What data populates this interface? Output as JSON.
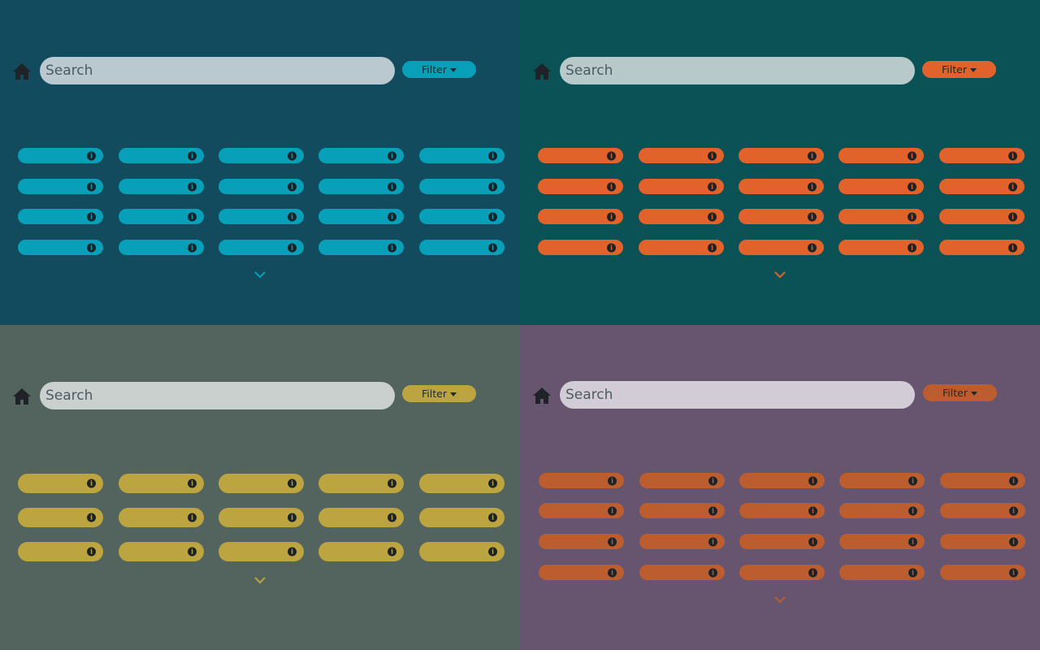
{
  "panels": [
    {
      "theme": "teal",
      "background": "#124a5e",
      "accent": "#08a0b8",
      "search_bg": "#b9c9cf",
      "search": {
        "placeholder": "Search",
        "value": ""
      },
      "filter": {
        "label": "Filter",
        "icon": "caret-down-icon"
      },
      "home_icon": "home-icon",
      "grid": {
        "rows": 4,
        "columns": 5,
        "item_icon": "info-icon"
      },
      "more_icon": "chevron-down-icon"
    },
    {
      "theme": "orange-on-teal",
      "background": "#0a5256",
      "accent": "#e2622c",
      "search_bg": "#b8c9ca",
      "search": {
        "placeholder": "Search",
        "value": ""
      },
      "filter": {
        "label": "Filter",
        "icon": "caret-down-icon"
      },
      "home_icon": "home-icon",
      "grid": {
        "rows": 4,
        "columns": 5,
        "item_icon": "info-icon"
      },
      "more_icon": "chevron-down-icon"
    },
    {
      "theme": "gold",
      "background": "#52645d",
      "accent": "#bca441",
      "search_bg": "#c9d0cd",
      "search": {
        "placeholder": "Search",
        "value": ""
      },
      "filter": {
        "label": "Filter",
        "icon": "caret-down-icon"
      },
      "home_icon": "home-icon",
      "grid": {
        "rows": 3,
        "columns": 5,
        "item_icon": "info-icon"
      },
      "more_icon": "chevron-down-icon"
    },
    {
      "theme": "orange-on-purple",
      "background": "#675570",
      "accent": "#bb5d2f",
      "search_bg": "#d1ccd5",
      "search": {
        "placeholder": "Search",
        "value": ""
      },
      "filter": {
        "label": "Filter",
        "icon": "caret-down-icon"
      },
      "home_icon": "home-icon",
      "grid": {
        "rows": 4,
        "columns": 5,
        "item_icon": "info-icon"
      },
      "more_icon": "chevron-down-icon"
    }
  ]
}
